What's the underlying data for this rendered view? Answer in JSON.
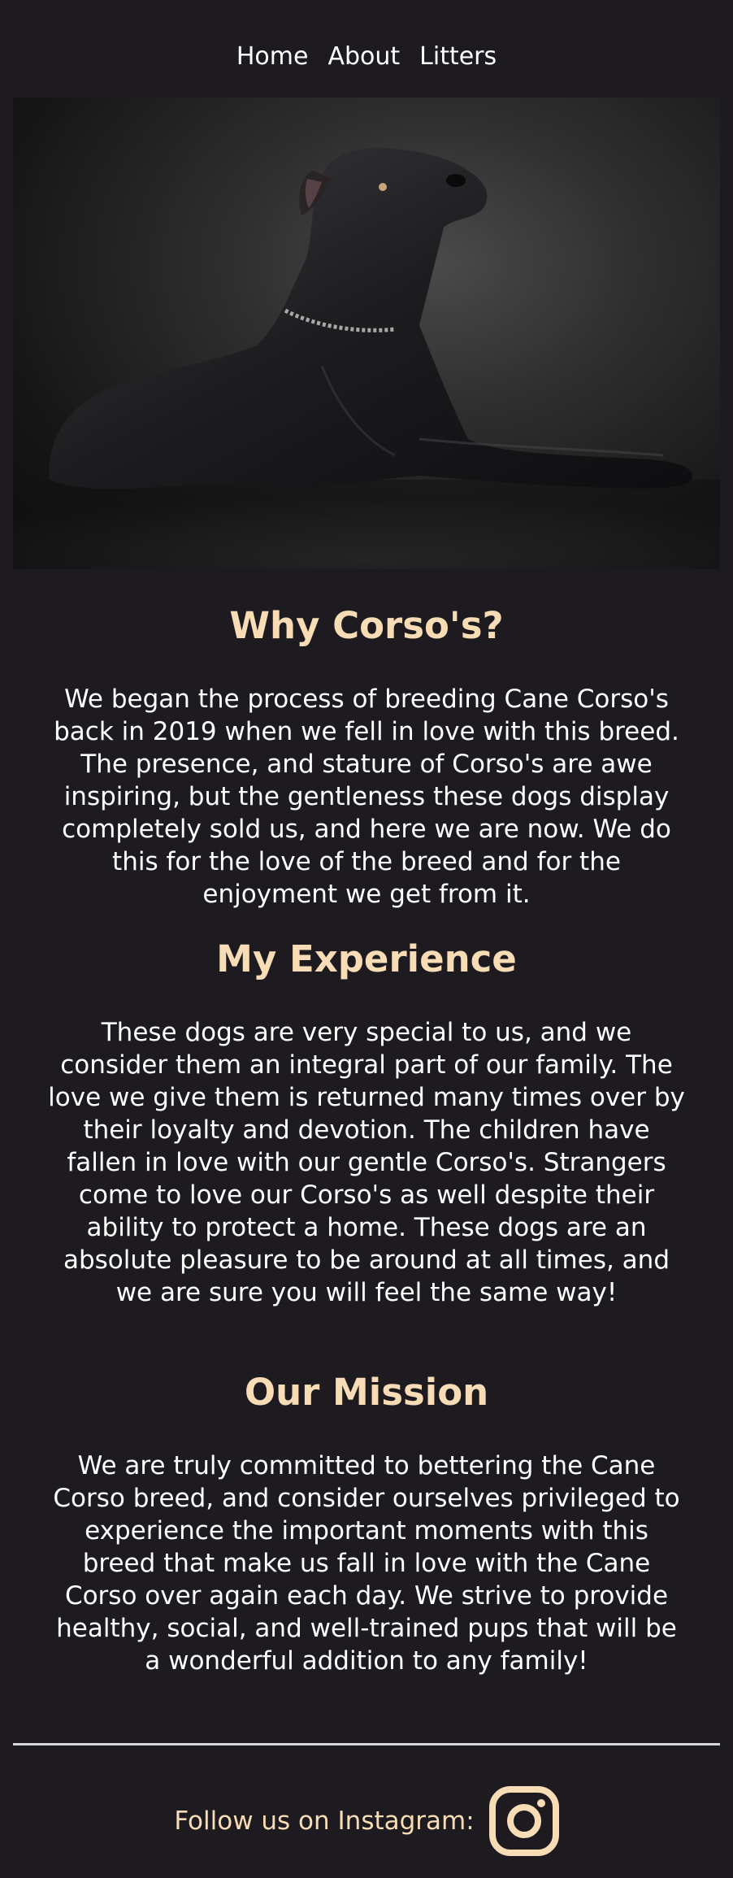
{
  "nav": {
    "items": [
      "Home",
      "About",
      "Litters"
    ]
  },
  "hero": {
    "image": "black Cane Corso dog lying down looking up",
    "icon": "dog-photo"
  },
  "sections": [
    {
      "title": "Why Corso's?",
      "body": "We began the process of breeding Cane Corso's back in 2019 when we fell in love with this breed. The presence, and stature of Corso's are awe inspiring, but the gentleness these dogs display completely sold us, and here we are now. We do this for the love of the breed and for the enjoyment we get from it."
    },
    {
      "title": "My Experience",
      "body": "These dogs are very special to us, and we consider them an integral part of our family. The love we give them is returned many times over by their loyalty and devotion. The children have fallen in love with our gentle Corso's. Strangers come to love our Corso's as well despite their ability to protect a home. These dogs are an absolute pleasure to be around at all times, and we are sure you will feel the same way!"
    },
    {
      "title": "Our Mission",
      "body": "We are truly committed to bettering the Cane Corso breed, and consider ourselves privileged to experience the important moments with this breed that make us fall in love with the Cane Corso over again each day. We strive to provide healthy, social, and well-trained pups that will be a wonderful addition to any family!"
    }
  ],
  "footer": {
    "label": "Follow us on Instagram:",
    "icon": "instagram-icon"
  },
  "colors": {
    "background": "#1e1b20",
    "accent": "#f7dcb5",
    "text": "#ffffff"
  }
}
